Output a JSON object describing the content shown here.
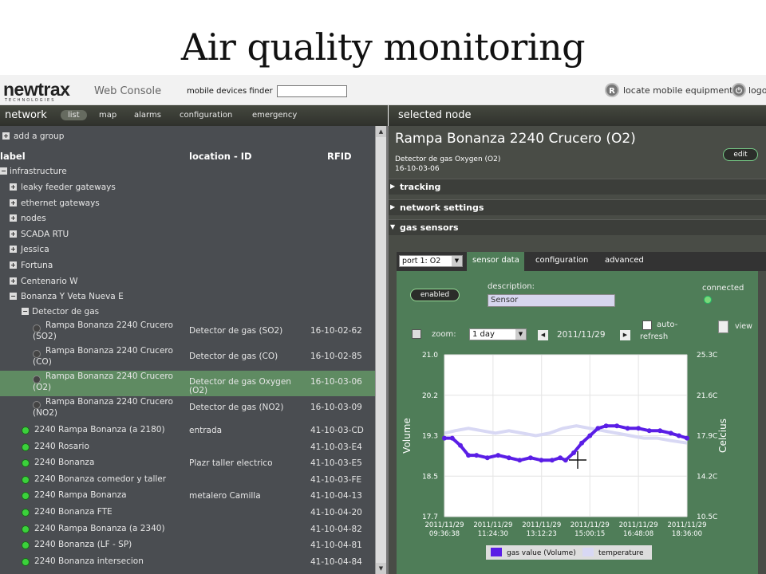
{
  "slide": {
    "title": "Air quality monitoring"
  },
  "topbar": {
    "logo": "newtrax",
    "logo_sub": "TECHNOLOGIES",
    "web_console": "Web Console",
    "finder_label": "mobile devices finder",
    "finder_value": "",
    "locate_label": "locate mobile equipment",
    "logout_label": "logo"
  },
  "nav": {
    "title": "network",
    "tabs": [
      "list",
      "map",
      "alarms",
      "configuration",
      "emergency"
    ],
    "active_tab": "list"
  },
  "tree": {
    "add_group": "add a group",
    "headers": {
      "label": "label",
      "location": "location - ID",
      "rfid": "RFID"
    },
    "infrastructure": "infrastructure",
    "groups": [
      "leaky feeder gateways",
      "ethernet gateways",
      "nodes",
      "SCADA RTU",
      "Jessica",
      "Fortuna",
      "Centenario W",
      "Bonanza Y Veta Nueva E"
    ],
    "subgroup": "Detector de gas",
    "detectors": [
      {
        "l1": "Rampa Bonanza 2240 Crucero",
        "l2": "(SO2)",
        "loc": "Detector de gas (SO2)",
        "loc2": "",
        "rfid": "16-10-02-62"
      },
      {
        "l1": "Rampa Bonanza 2240 Crucero",
        "l2": "(CO)",
        "loc": "Detector de gas (CO)",
        "loc2": "",
        "rfid": "16-10-02-85"
      },
      {
        "l1": "Rampa Bonanza 2240 Crucero",
        "l2": "(O2)",
        "loc": "Detector de gas Oxygen",
        "loc2": "(O2)",
        "rfid": "16-10-03-06"
      },
      {
        "l1": "Rampa Bonanza 2240 Crucero",
        "l2": "(NO2)",
        "loc": "Detector de gas (NO2)",
        "loc2": "",
        "rfid": "16-10-03-09"
      }
    ],
    "nodes": [
      {
        "label": "2240 Rampa Bonanza (a 2180)",
        "loc": "entrada",
        "rfid": "41-10-03-CD"
      },
      {
        "label": "2240 Rosario",
        "loc": "",
        "rfid": "41-10-03-E4"
      },
      {
        "label": "2240 Bonanza",
        "loc": "Plazr taller electrico",
        "rfid": "41-10-03-E5"
      },
      {
        "label": "2240 Bonanza comedor y taller",
        "loc": "",
        "rfid": "41-10-03-FE"
      },
      {
        "label": "2240 Rampa Bonanza",
        "loc": "metalero Camilla",
        "rfid": "41-10-04-13"
      },
      {
        "label": "2240 Bonanza FTE",
        "loc": "",
        "rfid": "41-10-04-20"
      },
      {
        "label": "2240 Rampa Bonanza (a 2340)",
        "loc": "",
        "rfid": "41-10-04-82"
      },
      {
        "label": "2240 Bonanza (LF - SP)",
        "loc": "",
        "rfid": "41-10-04-81"
      },
      {
        "label": "2240 Bonanza intersecion",
        "loc": "",
        "rfid": "41-10-04-84"
      }
    ]
  },
  "node": {
    "bar_title": "selected node",
    "title": "Rampa Bonanza 2240 Crucero (O2)",
    "subtitle": "Detector de gas Oxygen (O2)",
    "date": "16-10-03-06",
    "edit_label": "edit",
    "sections": [
      "tracking",
      "network settings",
      "gas sensors"
    ]
  },
  "sensor": {
    "port": "port 1: O2",
    "tabs": [
      "sensor data",
      "configuration",
      "advanced"
    ],
    "enabled_label": "enabled",
    "description_label": "description:",
    "description_value": "Sensor",
    "connected_label": "connected",
    "view_label": "view",
    "zoom_label": "zoom:",
    "zoom_value": "1 day",
    "date": "2011/11/29",
    "auto_refresh_1": "auto-",
    "auto_refresh_2": "refresh"
  },
  "colors": {
    "volume": "#5a1ee6",
    "temperature": "#d8d8f4",
    "panel_green": "#4f7d58"
  },
  "chart_data": {
    "type": "line",
    "ylabel": "Volume",
    "y2label": "Celcius",
    "ylim": [
      17.7,
      21.0
    ],
    "y2lim": [
      10.5,
      25.3
    ],
    "yticks": [
      "21.0",
      "20.2",
      "19.3",
      "18.5",
      "17.7"
    ],
    "y2ticks": [
      "25.3C",
      "21.6C",
      "17.9C",
      "14.2C",
      "10.5C"
    ],
    "x_ticks": [
      [
        "2011/11/29",
        "09:36:38"
      ],
      [
        "2011/11/29",
        "11:24:30"
      ],
      [
        "2011/11/29",
        "13:12:23"
      ],
      [
        "2011/11/29",
        "15:00:15"
      ],
      [
        "2011/11/29",
        "16:48:08"
      ],
      [
        "2011/11/29",
        "18:36:00"
      ]
    ],
    "x_hours": [
      9.61,
      11.41,
      13.21,
      15.0,
      16.8,
      18.6
    ],
    "series": [
      {
        "name": "gas value (Volume)",
        "x": [
          9.61,
          9.9,
          10.2,
          10.5,
          10.8,
          11.2,
          11.6,
          12.0,
          12.4,
          12.8,
          13.2,
          13.6,
          13.9,
          14.1,
          14.4,
          14.7,
          15.0,
          15.3,
          15.6,
          16.0,
          16.4,
          16.8,
          17.2,
          17.6,
          18.0,
          18.3,
          18.6
        ],
        "values": [
          19.3,
          19.3,
          19.15,
          18.95,
          18.95,
          18.9,
          18.95,
          18.9,
          18.85,
          18.9,
          18.85,
          18.85,
          18.9,
          18.85,
          19.0,
          19.2,
          19.35,
          19.5,
          19.55,
          19.55,
          19.5,
          19.5,
          19.45,
          19.45,
          19.4,
          19.35,
          19.3
        ]
      },
      {
        "name": "temperature",
        "x": [
          9.61,
          10.0,
          10.5,
          11.0,
          11.5,
          12.0,
          12.5,
          13.0,
          13.5,
          14.0,
          14.5,
          15.0,
          15.5,
          16.0,
          16.5,
          17.0,
          17.5,
          18.0,
          18.6
        ],
        "values": [
          19.4,
          19.45,
          19.5,
          19.45,
          19.4,
          19.45,
          19.4,
          19.35,
          19.4,
          19.5,
          19.55,
          19.5,
          19.45,
          19.4,
          19.35,
          19.3,
          19.3,
          19.25,
          19.2
        ]
      }
    ],
    "legend": "bottom"
  }
}
